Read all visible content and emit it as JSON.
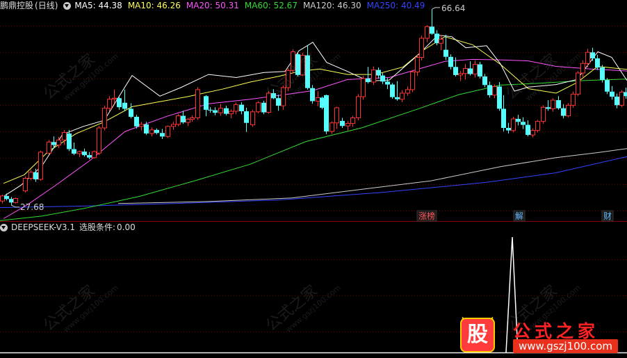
{
  "main": {
    "stock_name": "鹏鼎控股",
    "period": "(日线)",
    "ma": [
      {
        "label": "MA5: 44.38",
        "color": "#ffffff"
      },
      {
        "label": "MA10: 46.26",
        "color": "#ffff55"
      },
      {
        "label": "MA20: 50.31",
        "color": "#ff55ff"
      },
      {
        "label": "MA60: 52.67",
        "color": "#33dd33"
      },
      {
        "label": "MA120: 46.30",
        "color": "#cccccc"
      },
      {
        "label": "MA250: 40.49",
        "color": "#3344ff"
      }
    ],
    "high_label": "66.64",
    "low_label": "27.68",
    "events": [
      {
        "label": "涨榜",
        "color": "#ff5555"
      },
      {
        "label": "解",
        "color": "#66bbff"
      },
      {
        "label": "财",
        "color": "#66bbff"
      }
    ]
  },
  "indicator": {
    "name": "DEEPSEEK-V3.1",
    "condition_label": "选股条件:",
    "condition_value": "0.00"
  },
  "colors": {
    "up": "#ff3333",
    "down": "#55ffff",
    "background": "#000000",
    "grid": "#7a0000"
  },
  "watermark": {
    "text": "公式之家",
    "url": "www.gszj100.com"
  },
  "logo": {
    "badge": "股",
    "name": "公式之家",
    "url": "www.gszj100.com"
  }
}
